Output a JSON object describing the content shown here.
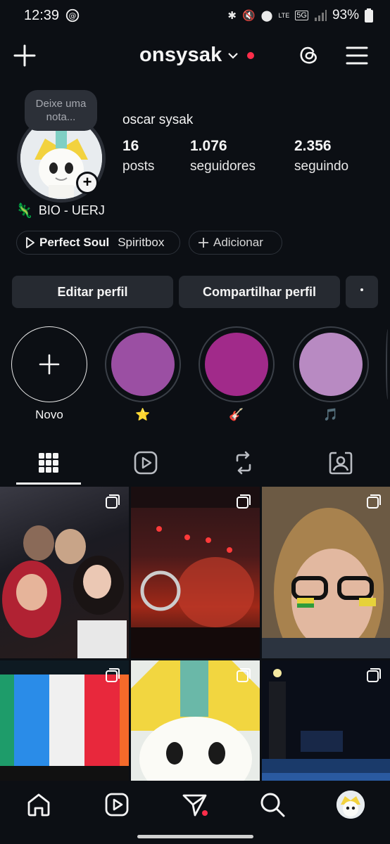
{
  "status_bar": {
    "time": "12:39",
    "battery": "93%",
    "network": "5G",
    "carrier_lte": "LTE"
  },
  "header": {
    "username": "onsysak"
  },
  "profile": {
    "note_placeholder": "Deixe uma nota...",
    "display_name": "oscar sysak",
    "stats": [
      {
        "value": "16",
        "label": "posts"
      },
      {
        "value": "1.076",
        "label": "seguidores"
      },
      {
        "value": "2.356",
        "label": "seguindo"
      }
    ],
    "bio_emoji": "🦎",
    "bio_text": "BIO - UERJ"
  },
  "music": {
    "song": "Perfect Soul",
    "artist": "Spiritbox",
    "add_label": "Adicionar"
  },
  "actions": {
    "edit": "Editar perfil",
    "share": "Compartilhar perfil"
  },
  "highlights": [
    {
      "label": "Novo"
    },
    {
      "label": "⭐",
      "color": "#9b4fa3"
    },
    {
      "label": "🎸",
      "color": "#a12a8a"
    },
    {
      "label": "🎵",
      "color": "#b88ac2"
    }
  ],
  "tabs": [
    "grid-icon",
    "reels-icon",
    "reposts-icon",
    "tagged-icon"
  ],
  "colors": {
    "background": "#0c0f14",
    "button": "#262a31",
    "notification_red": "#ff2d4a"
  }
}
